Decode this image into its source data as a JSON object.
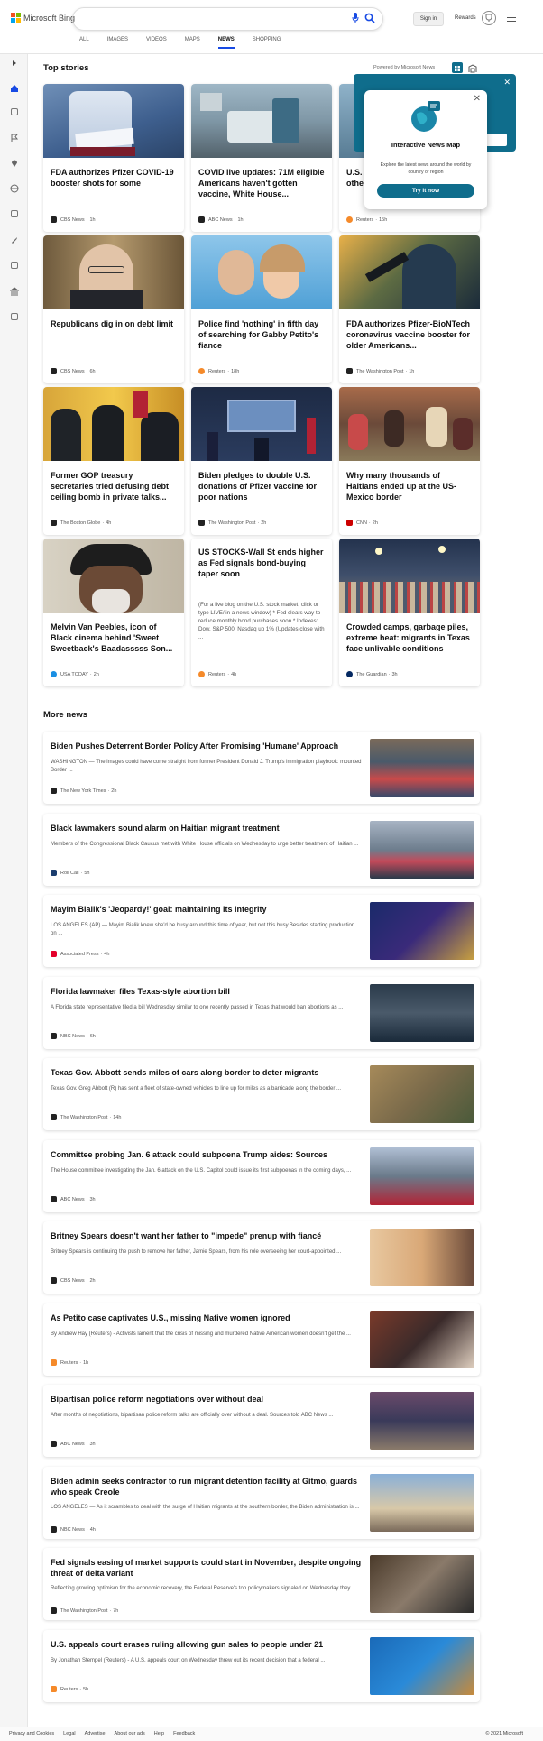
{
  "header": {
    "brand": "Microsoft Bing",
    "signin": "Sign in",
    "rewards": "Rewards"
  },
  "tabs": [
    "ALL",
    "IMAGES",
    "VIDEOS",
    "MAPS",
    "NEWS",
    "SHOPPING"
  ],
  "active_tab": "NEWS",
  "top_stories": {
    "title": "Top stories",
    "powered_by": "Powered by Microsoft News",
    "cards": [
      {
        "title": "FDA authorizes Pfizer COVID-19 booster shots for some",
        "source": "CBS News",
        "time": "1h",
        "src_color": "#222"
      },
      {
        "title": "COVID live updates: 71M eligible Americans haven't gotten vaccine, White House...",
        "source": "ABC News",
        "time": "1h",
        "src_color": "#222"
      },
      {
        "title": "U.S. COVI other",
        "source": "Reuters",
        "time": "15h",
        "src_color": "#f58a2a"
      },
      {
        "title": "Republicans dig in on debt limit",
        "source": "CBS News",
        "time": "6h",
        "src_color": "#222"
      },
      {
        "title": "Police find 'nothing' in fifth day of searching for Gabby Petito's fiance",
        "source": "Reuters",
        "time": "18h",
        "src_color": "#f58a2a"
      },
      {
        "title": "FDA authorizes Pfizer-BioNTech coronavirus vaccine booster for older Americans...",
        "source": "The Washington Post",
        "time": "1h",
        "src_color": "#222"
      },
      {
        "title": "Former GOP treasury secretaries tried defusing debt ceiling bomb in private talks...",
        "source": "The Boston Globe",
        "time": "4h",
        "src_color": "#222"
      },
      {
        "title": "Biden pledges to double U.S. donations of Pfizer vaccine for poor nations",
        "source": "The Washington Post",
        "time": "2h",
        "src_color": "#222"
      },
      {
        "title": "Why many thousands of Haitians ended up at the US-Mexico border",
        "source": "CNN",
        "time": "2h",
        "src_color": "#cc0000"
      },
      {
        "title": "Melvin Van Peebles, icon of Black cinema behind 'Sweet Sweetback's Baadasssss Son...",
        "source": "USA TODAY",
        "time": "2h",
        "src_color": "#1a8fe3"
      },
      {
        "title": "US STOCKS-Wall St ends higher as Fed signals bond-buying taper soon",
        "snippet": "(For a live blog on the U.S. stock market, click or type LIVE/ in a news window) * Fed clears way to reduce monthly bond purchases soon * Indexes: Dow, S&P 500, Nasdaq up 1% (Updates close with ...",
        "source": "Reuters",
        "time": "4h",
        "src_color": "#f58a2a"
      },
      {
        "title": "Crowded camps, garbage piles, extreme heat: migrants in Texas face unlivable conditions",
        "source": "The Guardian",
        "time": "3h",
        "src_color": "#052962"
      }
    ]
  },
  "popup": {
    "title": "Interactive News Map",
    "text": "Explore the latest news around the world by country or region",
    "button": "Try it now"
  },
  "more_news": {
    "title": "More news",
    "items": [
      {
        "title": "Biden Pushes Deterrent Border Policy After Promising 'Humane' Approach",
        "snippet": "WASHINGTON — The images could have come straight from former President Donald J. Trump's immigration playbook: mounted Border ...",
        "source": "The New York Times",
        "time": "2h",
        "src_color": "#222"
      },
      {
        "title": "Black lawmakers sound alarm on Haitian migrant treatment",
        "snippet": "Members of the Congressional Black Caucus met with White House officials on Wednesday to urge better treatment of Haitian ...",
        "source": "Roll Call",
        "time": "5h",
        "src_color": "#1b3d6e"
      },
      {
        "title": "Mayim Bialik's 'Jeopardy!' goal: maintaining its integrity",
        "snippet": "LOS ANGELES (AP) — Mayim Bialik knew she'd be busy around this time of year, but not this busy.Besides starting production on ...",
        "source": "Associated Press",
        "time": "4h",
        "src_color": "#e4002b"
      },
      {
        "title": "Florida lawmaker files Texas-style abortion bill",
        "snippet": "A Florida state representative filed a bill Wednesday similar to one recently passed in Texas that would ban abortions as ...",
        "source": "NBC News",
        "time": "6h",
        "src_color": "#222"
      },
      {
        "title": "Texas Gov. Abbott sends miles of cars along border to deter migrants",
        "snippet": "Texas Gov. Greg Abbott (R) has sent a fleet of state-owned vehicles to line up for miles as a barricade along the border ...",
        "source": "The Washington Post",
        "time": "14h",
        "src_color": "#222"
      },
      {
        "title": "Committee probing Jan. 6 attack could subpoena Trump aides: Sources",
        "snippet": "The House committee investigating the Jan. 6 attack on the U.S. Capitol could issue its first subpoenas in the coming days, ...",
        "source": "ABC News",
        "time": "3h",
        "src_color": "#222"
      },
      {
        "title": "Britney Spears doesn't want her father to \"impede\" prenup with fiancé",
        "snippet": "Britney Spears is continuing the push to remove her father, Jamie Spears, from his role overseeing her court-appointed ...",
        "source": "CBS News",
        "time": "2h",
        "src_color": "#222"
      },
      {
        "title": "As Petito case captivates U.S., missing Native women ignored",
        "snippet": "By Andrew Hay (Reuters) - Activists lament that the crisis of missing and murdered Native American women doesn't get the ...",
        "source": "Reuters",
        "time": "1h",
        "src_color": "#f58a2a"
      },
      {
        "title": "Bipartisan police reform negotiations over without deal",
        "snippet": "After months of negotiations, bipartisan police reform talks are officially over without a deal. Sources told ABC News ...",
        "source": "ABC News",
        "time": "3h",
        "src_color": "#222"
      },
      {
        "title": "Biden admin seeks contractor to run migrant detention facility at Gitmo, guards who speak Creole",
        "snippet": "LOS ANGELES — As it scrambles to deal with the surge of Haitian migrants at the southern border, the Biden administration is ...",
        "source": "NBC News",
        "time": "4h",
        "src_color": "#222"
      },
      {
        "title": "Fed signals easing of market supports could start in November, despite ongoing threat of delta variant",
        "snippet": "Reflecting growing optimism for the economic recovery, the Federal Reserve's top policymakers signaled on Wednesday they ...",
        "source": "The Washington Post",
        "time": "7h",
        "src_color": "#222"
      },
      {
        "title": "U.S. appeals court erases ruling allowing gun sales to people under 21",
        "snippet": "By Jonathan Stempel (Reuters) - A U.S. appeals court on Wednesday threw out its recent decision that a federal ...",
        "source": "Reuters",
        "time": "5h",
        "src_color": "#f58a2a"
      }
    ]
  },
  "footer": {
    "links": [
      "Privacy and Cookies",
      "Legal",
      "Advertise",
      "About our ads",
      "Help",
      "Feedback"
    ],
    "copyright": "© 2021 Microsoft"
  }
}
